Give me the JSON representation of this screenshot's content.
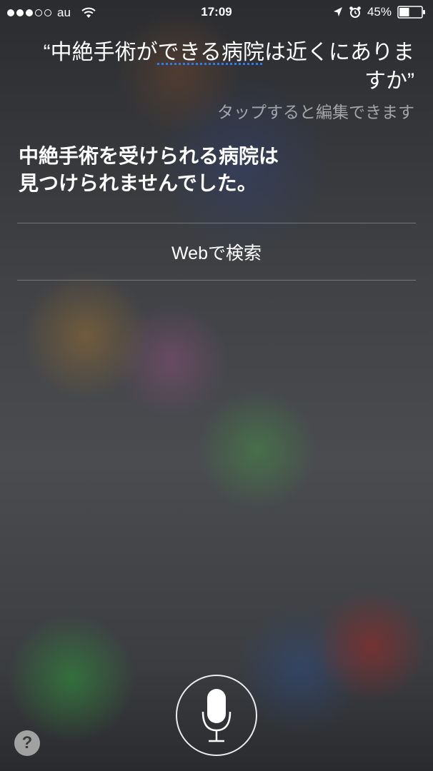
{
  "status_bar": {
    "carrier": "au",
    "signal_strength": 3,
    "signal_max": 5,
    "time": "17:09",
    "battery_percent": "45%",
    "battery_level": 0.45,
    "icons": [
      "signal-dots-icon",
      "wifi-icon",
      "location-arrow-icon",
      "alarm-icon",
      "battery-icon"
    ]
  },
  "siri": {
    "query_open_quote": "“",
    "query_pre": "中絶手術が",
    "query_underlined": "できる病院",
    "query_post": "は近くにありますか",
    "query_close_quote": "”",
    "tap_to_edit": "タップすると編集できます",
    "answer_line1": "中絶手術を受けられる病院は",
    "answer_line2": "見つけられませんでした。",
    "web_search_label": "Webで検索",
    "help_label": "?"
  },
  "colors": {
    "underline_accent": "#2f7cf6",
    "text": "#ffffff",
    "hint_text": "rgba(255,255,255,0.55)"
  }
}
